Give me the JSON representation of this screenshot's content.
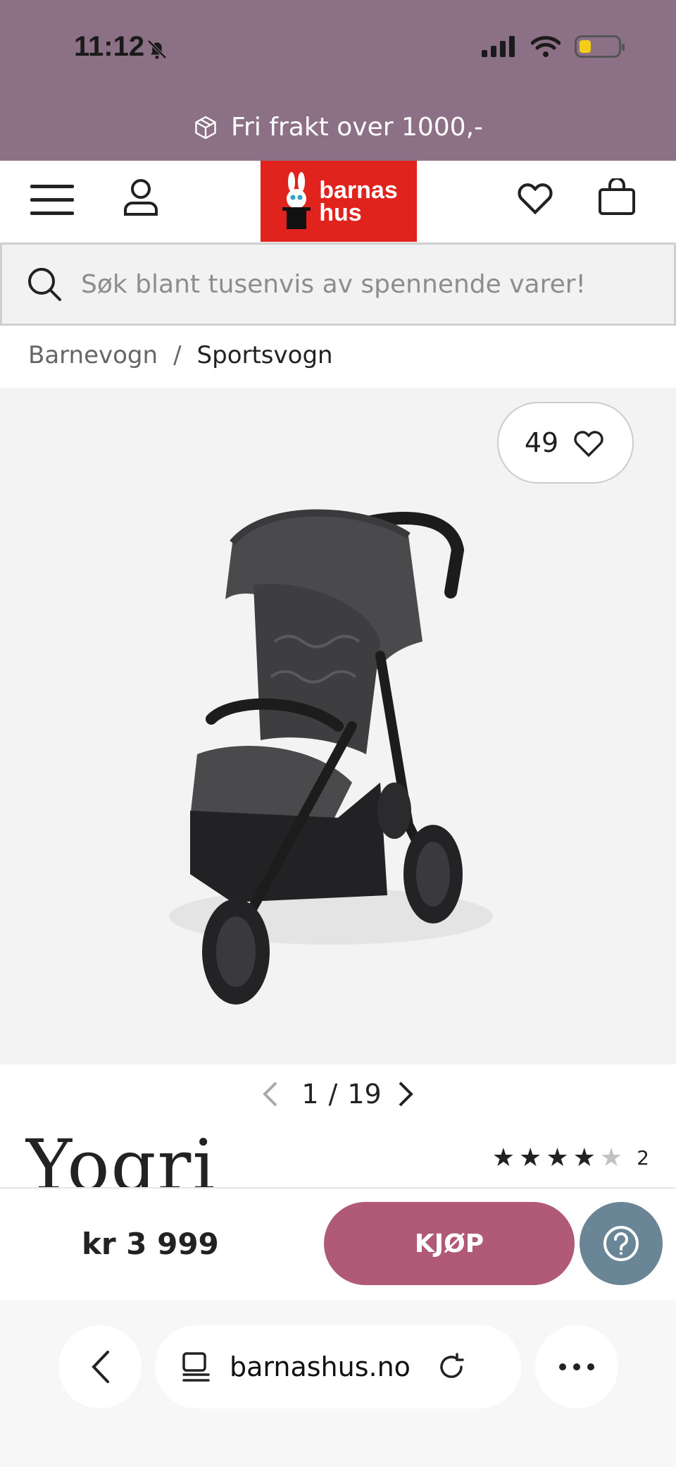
{
  "status_bar": {
    "time": "11:12"
  },
  "promo": {
    "text": "Fri frakt over 1000,-"
  },
  "header": {
    "logo_line1": "barnas",
    "logo_line2": "hus"
  },
  "search": {
    "placeholder": "Søk blant tusenvis av spennende varer!"
  },
  "breadcrumb": {
    "items": [
      "Barnevogn",
      "/",
      "Sportsvogn"
    ]
  },
  "product": {
    "favorite_count": "49",
    "image_pager": {
      "current": "1",
      "separator": "/",
      "total": "19"
    },
    "brand": "Yogri",
    "rating": {
      "stars": 4,
      "max": 5,
      "review_count": "2"
    },
    "price": "kr 3 999",
    "buy_label": "KJØP"
  },
  "browser": {
    "url": "barnashus.no"
  },
  "colors": {
    "promo_bg": "#8c7085",
    "logo_red": "#e0241d",
    "buy_button": "#b05a78",
    "help_button": "#6a8596"
  }
}
